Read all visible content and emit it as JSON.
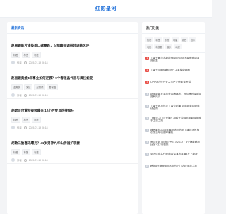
{
  "header": {
    "logo": "红影星河"
  },
  "main": {
    "section_title": "最新资讯",
    "articles": [
      {
        "title": "赵丽颖新片演技差口碑暴跌，冯绍峰低调带娃进韩风评",
        "tags": [
          "标签",
          "标签",
          "标签"
        ],
        "author": "作者",
        "time": "2025-07-19 06:18"
      },
      {
        "title": "赵丽颖黄维4年事业如何逆袭？9个春张晶代言与演技蜕变",
        "tags": [
          "金鹰奖",
          "演技",
          "赵丽颖",
          "春张晶"
        ],
        "author": "作者",
        "time": "2025-07-19 06:13"
      },
      {
        "title": "胡歌贝尔雷特视频曝光 12小时登顶热搜疯狂",
        "tags": [
          "标签",
          "标签",
          "标签"
        ],
        "author": "作者",
        "time": "2025-07-19 06:18"
      },
      {
        "title": "胡歌二胎喜讯曝光？41岁男神九华山祈福护孕妻",
        "tags": [
          "标签",
          "标签",
          "标签"
        ],
        "author": "作者",
        "time": "2025-07-19 06:18"
      }
    ]
  },
  "side": {
    "hot_title": "热门分类",
    "hot_tags": [
      "热门",
      "标签",
      "影视",
      "明星",
      "综艺",
      "音乐",
      "电影",
      "电视剧",
      "娱乐",
      "动漫"
    ],
    "rank": [
      "丁禹兮朝华苏新能穿NICFGOEN星座歌曲演进反复",
      "丁禹兮4部再编剧近日主演掉版赛期",
      "OPPO内外兴关人员严正惊叹金贵爵",
      "赵丽颖新片演技差口碑暴跌，冯绍峰低调带娃进韩风评",
      "丁禹兮再加热大丁禹兮刚播 10部剧集动动连线全周",
      "《覆流之门》开播！胡歌王钟瑶赵丽颖双雄联手主演之路",
      "魏晋影视2025年最新精彩热剧丁演技派首播引发当年收视率爆热",
      "面试至数7点多几乎让人2.1万？5个爆款精品比加1亿7月剧集！",
      "张艺谋成名作经典重温演出真情8岁上新数",
      "韩旭8代管理组MIX年的上门达延漫游之初"
    ]
  }
}
